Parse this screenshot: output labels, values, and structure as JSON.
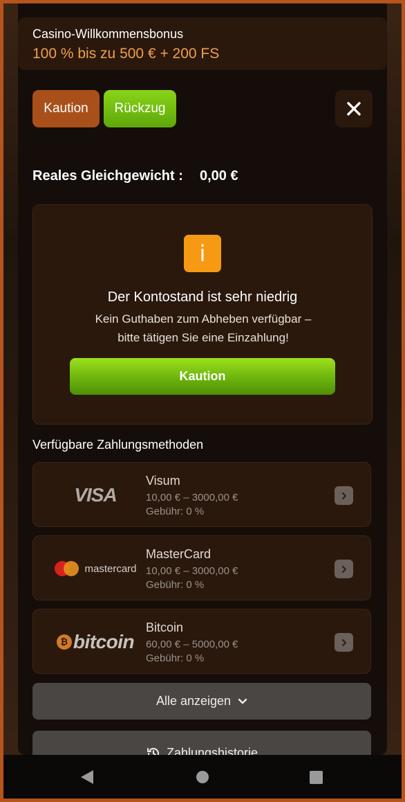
{
  "bonus": {
    "title": "Casino-Willkommensbonus",
    "value": "100 % bis zu 500 € + 200 FS",
    "value_color": "#f0a04a"
  },
  "tabs": {
    "deposit_label": "Kaution",
    "withdraw_label": "Rückzug",
    "active": "withdraw"
  },
  "balance": {
    "label": "Reales Gleichgewicht :",
    "value": "0,00 €"
  },
  "alert": {
    "icon": "info-icon",
    "icon_glyph": "i",
    "title": "Der Kontostand ist sehr niedrig",
    "text_line1": "Kein Guthaben zum Abheben verfügbar –",
    "text_line2": "bitte tätigen Sie eine Einzahlung!",
    "button_label": "Kaution"
  },
  "methods_section": {
    "title": "Verfügbare Zahlungsmethoden",
    "items": [
      {
        "logo": "visa-logo",
        "logo_text": "VISA",
        "name": "Visum",
        "range": "10,00 € – 3000,00 €",
        "fee": "Gebühr: 0 %"
      },
      {
        "logo": "mastercard-logo",
        "logo_text": "mastercard",
        "name": "MasterCard",
        "range": "10,00 € – 3000,00 €",
        "fee": "Gebühr: 0 %"
      },
      {
        "logo": "bitcoin-logo",
        "logo_text": "bitcoin",
        "name": "Bitcoin",
        "range": "60,00 € – 5000,00 €",
        "fee": "Gebühr: 0 %"
      }
    ]
  },
  "show_all_label": "Alle anzeigen",
  "history_label": "Zahlungshistorie",
  "colors": {
    "accent_orange": "#a9501a",
    "accent_green": "#6cb40d",
    "info_orange": "#f59a12"
  }
}
